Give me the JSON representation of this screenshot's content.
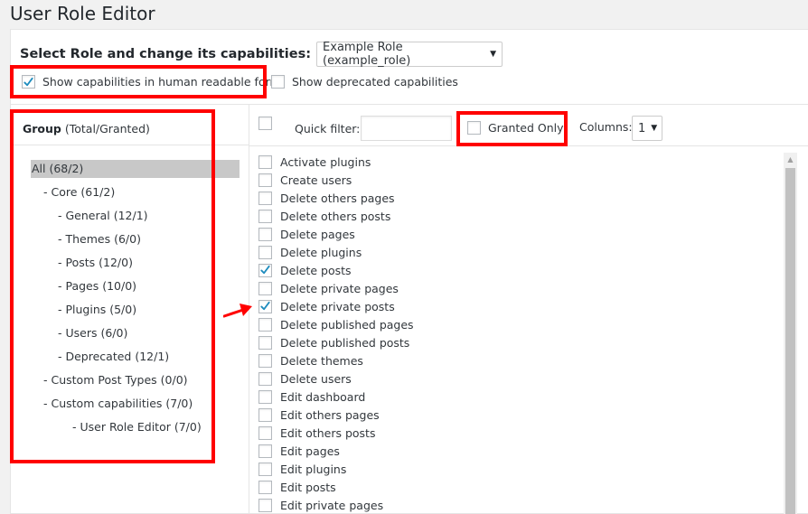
{
  "page": {
    "title": "User Role Editor"
  },
  "role_select": {
    "label": "Select Role and change its capabilities:",
    "value": "Example Role (example_role)"
  },
  "options": {
    "human_readable": {
      "label": "Show capabilities in human readable form",
      "checked": true
    },
    "deprecated": {
      "label": "Show deprecated capabilities",
      "checked": false
    }
  },
  "groups": {
    "header_bold": "Group",
    "header_rest": "(Total/Granted)",
    "items": [
      {
        "label": "All (68/2)",
        "selected": true
      },
      {
        "label": "- Core (61/2)"
      },
      {
        "label": "- General (12/1)"
      },
      {
        "label": "- Themes (6/0)"
      },
      {
        "label": "- Posts (12/0)"
      },
      {
        "label": "- Pages (10/0)"
      },
      {
        "label": "- Plugins (5/0)"
      },
      {
        "label": "- Users (6/0)"
      },
      {
        "label": "- Deprecated (12/1)"
      },
      {
        "label": "- Custom Post Types (0/0)"
      },
      {
        "label": "- Custom capabilities (7/0)"
      },
      {
        "label": "- User Role Editor (7/0)"
      }
    ]
  },
  "filter": {
    "quick_filter_label": "Quick filter:",
    "quick_filter_value": "",
    "granted_only_label": "Granted Only",
    "columns_label": "Columns:",
    "columns_value": "1"
  },
  "capabilities": [
    {
      "label": "Activate plugins",
      "checked": false
    },
    {
      "label": "Create users",
      "checked": false
    },
    {
      "label": "Delete others pages",
      "checked": false
    },
    {
      "label": "Delete others posts",
      "checked": false
    },
    {
      "label": "Delete pages",
      "checked": false
    },
    {
      "label": "Delete plugins",
      "checked": false
    },
    {
      "label": "Delete posts",
      "checked": true
    },
    {
      "label": "Delete private pages",
      "checked": false
    },
    {
      "label": "Delete private posts",
      "checked": true
    },
    {
      "label": "Delete published pages",
      "checked": false
    },
    {
      "label": "Delete published posts",
      "checked": false
    },
    {
      "label": "Delete themes",
      "checked": false
    },
    {
      "label": "Delete users",
      "checked": false
    },
    {
      "label": "Edit dashboard",
      "checked": false
    },
    {
      "label": "Edit others pages",
      "checked": false
    },
    {
      "label": "Edit others posts",
      "checked": false
    },
    {
      "label": "Edit pages",
      "checked": false
    },
    {
      "label": "Edit plugins",
      "checked": false
    },
    {
      "label": "Edit posts",
      "checked": false
    },
    {
      "label": "Edit private pages",
      "checked": false
    }
  ],
  "colors": {
    "highlight": "#ff0000",
    "check": "#1e8cbe",
    "selected_group": "#c8c8c8"
  }
}
